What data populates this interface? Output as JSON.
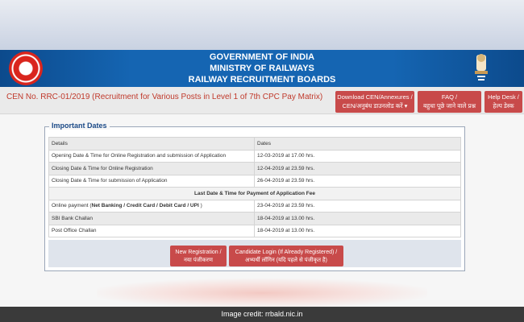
{
  "header": {
    "line1": "GOVERNMENT OF INDIA",
    "line2": "MINISTRY OF RAILWAYS",
    "line3": "RAILWAY RECRUITMENT BOARDS"
  },
  "subbar": {
    "cen_title": "CEN No. RRC-01/2019 (Recruitment for Various Posts in Level 1 of 7th CPC Pay Matrix)",
    "download_line1": "Download CEN/Annexures /",
    "download_line2": "CEN/अनुबंध डाउनलोड करें ▾",
    "faq_line1": "FAQ /",
    "faq_line2": "बहुधा पूछे जाने वाले प्रश्न",
    "help_line1": "Help Desk /",
    "help_line2": "हेल्प डेस्क"
  },
  "important_dates": {
    "legend": "Important Dates",
    "col_details": "Details",
    "col_dates": "Dates",
    "rows": [
      {
        "detail": "Opening Date & Time for Online Registration and submission of Application",
        "date": "12-03-2019 at 17.00 hrs."
      },
      {
        "detail": "Closing Date & Time for Online Registration",
        "date": "12-04-2019 at 23.59 hrs."
      },
      {
        "detail": "Closing Date & Time for submission of Application",
        "date": "26-04-2019 at 23.59 hrs."
      }
    ],
    "payment_header": "Last Date & Time for Payment of Application Fee",
    "online_prefix": "Online payment (",
    "online_bold": "Net Banking / Credit Card / Debit Card / UPI",
    "online_suffix": " )",
    "online_date": "23-04-2019 at 23.59 hrs.",
    "payment_rows": [
      {
        "detail": "SBI Bank Challan",
        "date": "18-04-2019 at 13.00 hrs."
      },
      {
        "detail": "Post Office Challan",
        "date": "18-04-2019 at 13.00 hrs."
      }
    ]
  },
  "actions": {
    "new_reg_line1": "New Registration /",
    "new_reg_line2": "नया पंजीकरण",
    "login_line1": "Candidate Login (If Already Registered) /",
    "login_line2": "अभ्यर्थी लॉगिन (यदि पहले से पंजीकृत है)"
  },
  "footer": {
    "credit": "Image credit: rrbald.nic.in"
  },
  "colors": {
    "header_blue": "#1565b2",
    "button_red": "#c84a4a",
    "title_red": "#c0392b"
  }
}
